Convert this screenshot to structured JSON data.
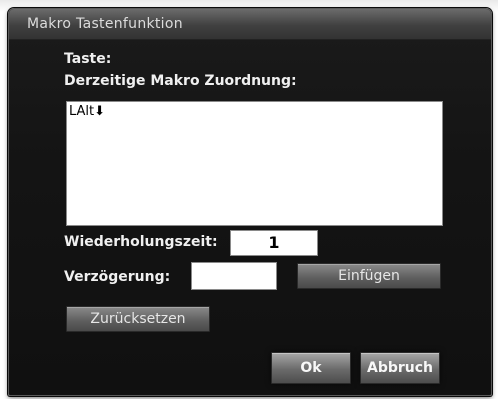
{
  "dialog": {
    "title": "Makro Tastenfunktion",
    "key_label": "Taste:",
    "assignment_label": "Derzeitige Makro Zuordnung:",
    "assignment_value": "LAlt⬇",
    "repeat_label": "Wiederholungszeit:",
    "repeat_value": "1",
    "delay_label": "Verzögerung:",
    "delay_value": "",
    "insert_label": "Einfügen",
    "reset_label": "Zurücksetzen",
    "ok_label": "Ok",
    "cancel_label": "Abbruch"
  }
}
